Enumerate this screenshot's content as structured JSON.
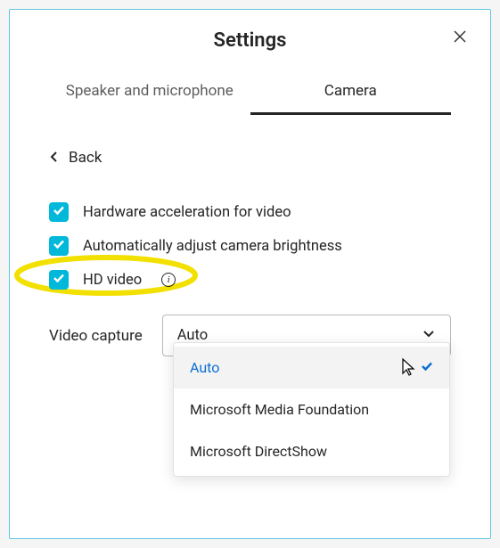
{
  "title": "Settings",
  "tabs": [
    {
      "label": "Speaker and microphone",
      "active": false
    },
    {
      "label": "Camera",
      "active": true
    }
  ],
  "back_label": "Back",
  "options": [
    {
      "label": "Hardware acceleration for video",
      "checked": true,
      "has_info": false
    },
    {
      "label": "Automatically adjust camera brightness",
      "checked": true,
      "has_info": false
    },
    {
      "label": "HD video",
      "checked": true,
      "has_info": true,
      "highlighted": true
    }
  ],
  "video_capture": {
    "label": "Video capture",
    "selected": "Auto",
    "dropdown_open": true,
    "items": [
      {
        "label": "Auto",
        "selected": true
      },
      {
        "label": "Microsoft Media Foundation",
        "selected": false
      },
      {
        "label": "Microsoft DirectShow",
        "selected": false
      }
    ]
  },
  "colors": {
    "accent": "#00b8d9",
    "highlight": "#f2e000"
  }
}
